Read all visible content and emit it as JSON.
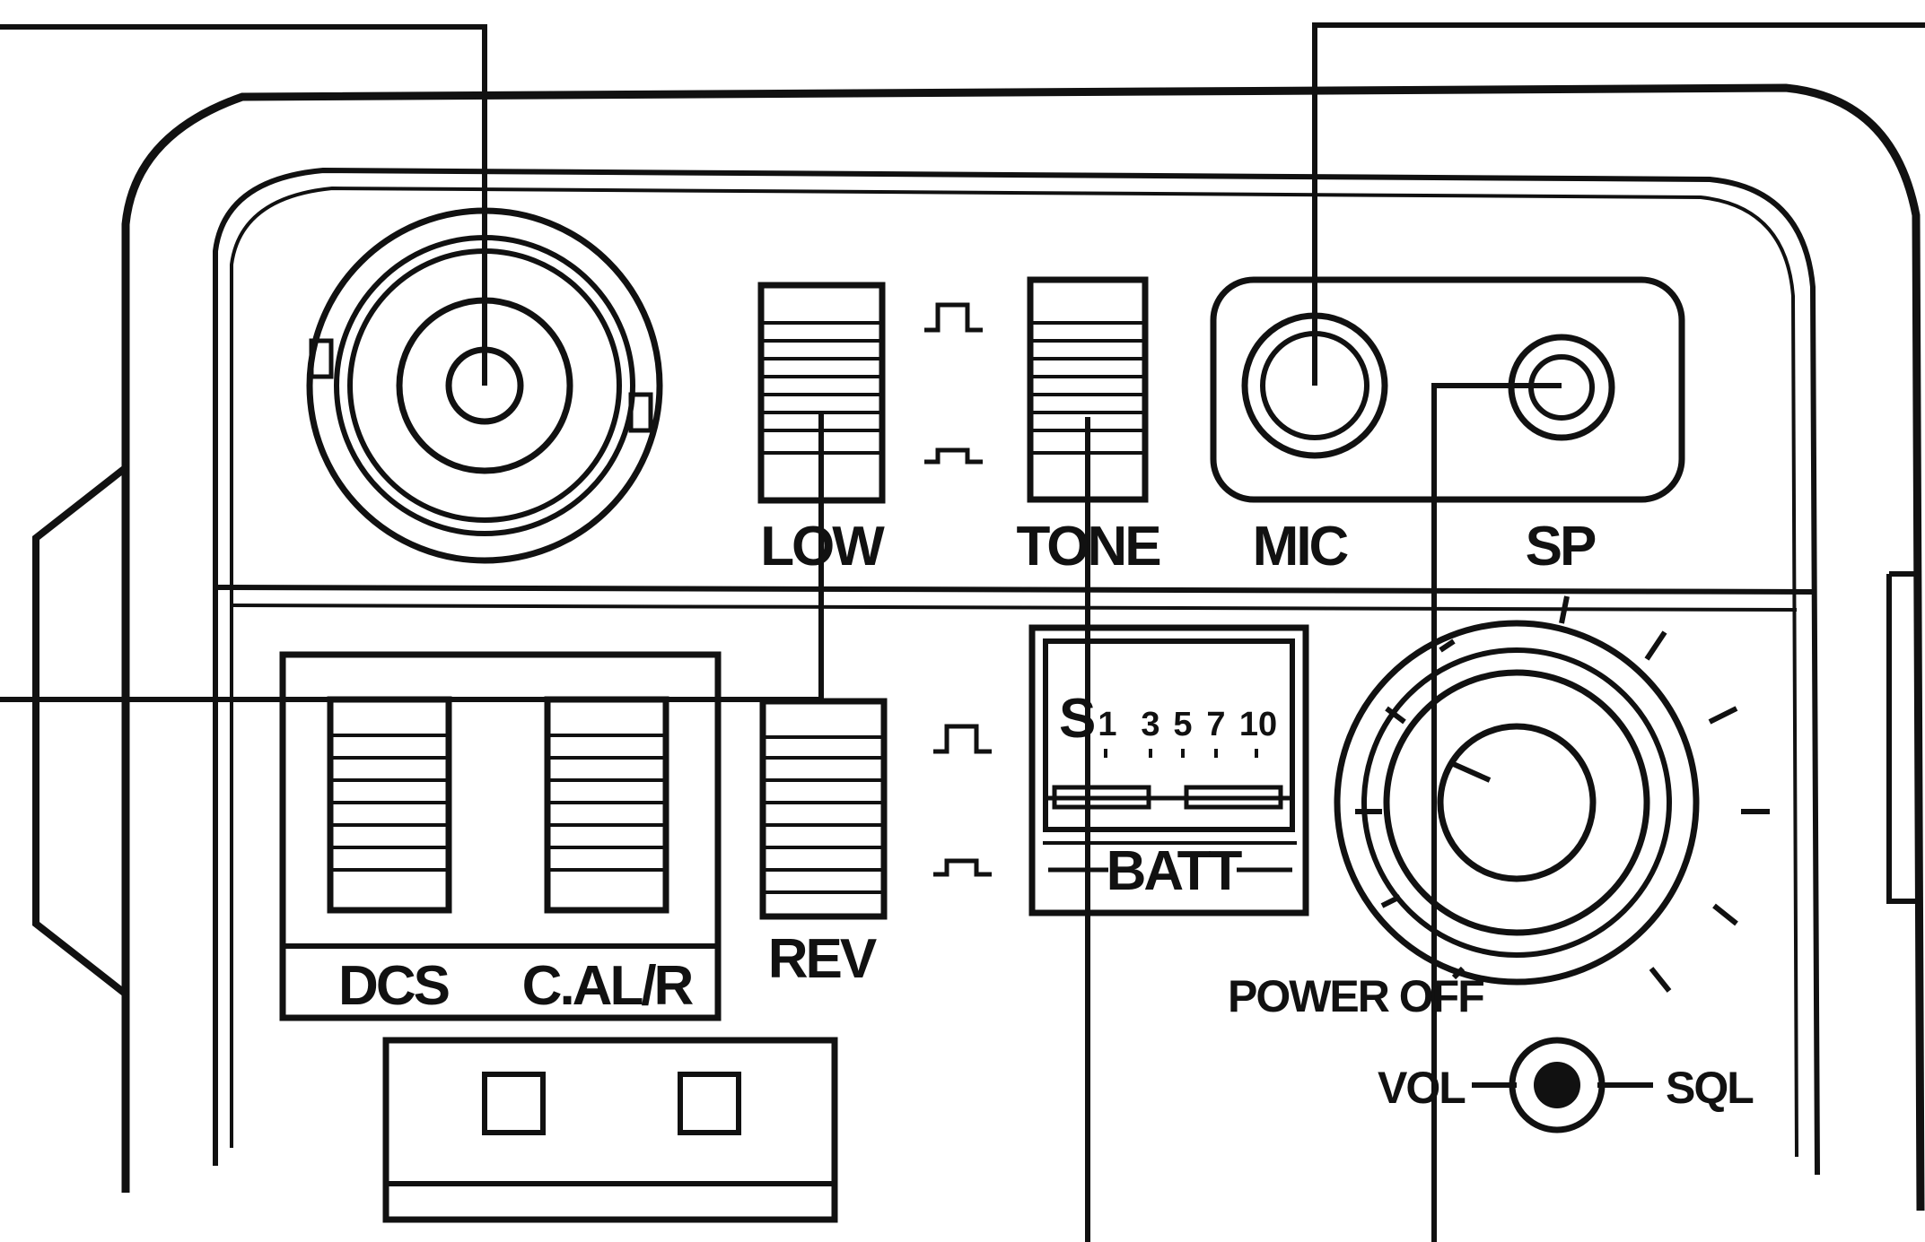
{
  "colors": {
    "ink": "#111111",
    "paper": "#ffffff",
    "light": "#e8e8e8"
  },
  "top_panel": {
    "connector": {
      "icon": "bnc-antenna-connector"
    },
    "low_switch": {
      "label": "LOW",
      "icon": "slide-switch-icon"
    },
    "tone_switch": {
      "label": "TONE",
      "icon": "slide-switch-icon"
    },
    "mic_jack": {
      "label": "MIC",
      "icon": "jack-icon"
    },
    "sp_jack": {
      "label": "SP",
      "icon": "jack-icon"
    },
    "position_symbols": [
      "switch-up-position-icon",
      "switch-down-position-icon"
    ]
  },
  "bottom_panel": {
    "dcs_switch": {
      "label": "DCS"
    },
    "cal_switch": {
      "label": "C.AL/R"
    },
    "rev_switch": {
      "label": "REV"
    },
    "meter": {
      "s_label": "S",
      "scale": [
        "1",
        "3",
        "5",
        "7",
        "10"
      ],
      "batt_label": "BATT"
    },
    "power_knob": {
      "label": "POWER OFF",
      "icon": "rotary-knob-icon"
    },
    "vol_sql": {
      "left_label": "VOL",
      "right_label": "SQL",
      "icon": "dual-knob-icon"
    },
    "battery_latch": {
      "icon": "battery-latch-icon"
    }
  }
}
